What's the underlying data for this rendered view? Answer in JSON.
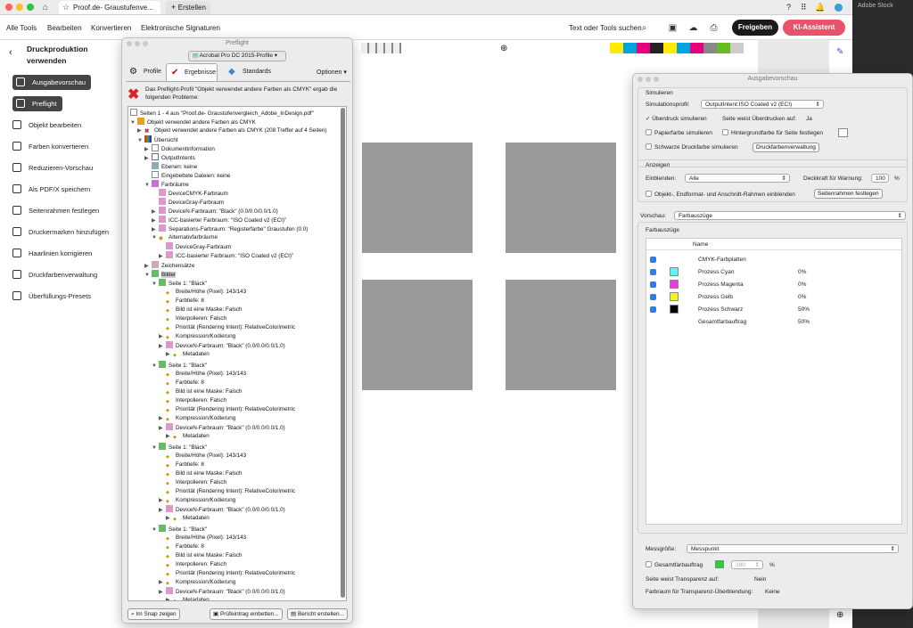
{
  "titlebar": {
    "tab1": "Proof.de- Graustufenve...",
    "tab2": "Erstellen",
    "app_label": "Adobe Stock"
  },
  "menubar": {
    "items": [
      "Alle Tools",
      "Bearbeiten",
      "Konvertieren",
      "Elektronische Signaturen"
    ],
    "search": "Text oder Tools suchen",
    "share": "Freigeben",
    "ai": "KI-Assistent"
  },
  "left": {
    "title1": "Druckproduktion",
    "title2": "verwenden",
    "items": [
      "Ausgabevorschau",
      "Preflight",
      "Objekt bearbeiten",
      "Farben konvertieren",
      "Reduzieren-Vorschau",
      "Als PDF/X speichern",
      "Seitenrahmen festlegen",
      "Druckermarken hinzufügen",
      "Haarlinien korrigieren",
      "Druckfarbenverwaltung",
      "Überfüllungs-Presets"
    ]
  },
  "preflight": {
    "title": "Preflight",
    "profile": "Acrobat Pro DC 2015-Profile",
    "tabs": [
      "Profile",
      "Ergebnisse",
      "Standards"
    ],
    "options": "Optionen",
    "msg": "Das Preflight-Profil \"Objekt verwendet andere Farben als CMYK\" ergab die folgenden Probleme:",
    "tree": [
      "Seiten 1 - 4 aus \"Proof.de- Graustufenvergleich_Adobe_InDesign.pdf\"",
      "Objekt verwendet andere Farben als CMYK",
      "Objekt verwendet andere Farben als CMYK (208 Treffer auf 4 Seiten)",
      "Übersicht",
      "Dokumentinformation",
      "OutputIntents",
      "Ebenen: keine",
      "Eingebettete Dateien: keine",
      "Farbräume",
      "DeviceCMYK-Farbraum",
      "DeviceGray-Farbraum",
      "DeviceN-Farbraum: \"Black\"  (0.0/0.0/0.0/1.0)",
      "ICC-basierter Farbraum: \"ISO Coated v2 (ECI)\"",
      "Separations-Farbraum: \"Registerfarbe\" Graustufen (0.0)",
      "Alternativfarbräume",
      "DeviceGray-Farbraum",
      "ICC-basierter Farbraum: \"ISO Coated v2 (ECI)\"",
      "Zeichensätze",
      "Bilder"
    ],
    "block": [
      "Seite 1: \"Black\"",
      "Breite/Höhe (Pixel): 143/143",
      "Farbtiefe: 8",
      "Bild ist eine Maske: Falsch",
      "Interpolieren: Falsch",
      "Priorität (Rendering Intent): RelativeColorimetric",
      "Kompression/Kodierung",
      "DeviceN-Farbraum: \"Black\"  (0.0/0.0/0.0/1.0)",
      "Metadaten"
    ],
    "btn_snap": "Im Snap zeigen",
    "btn_embed": "Prüfeintrag einbetten...",
    "btn_report": "Bericht erstellen..."
  },
  "av": {
    "title": "Ausgabevorschau",
    "simulieren": "Simulieren",
    "simprofil_label": "Simulationsprofil:",
    "simprofil": "OutputIntent:ISO Coated v2 (ECI)",
    "ueberdruck": "Überdruck simulieren",
    "weiss_label": "Seite weist Überdrucken auf:",
    "weiss_val": "Ja",
    "papier": "Papierfarbe simulieren",
    "hinter": "Hintergrundfarbe für Seite festlegen",
    "schwarz": "Schwarze Druckfarbe simulieren",
    "dfv_btn": "Druckfarbenverwaltung",
    "anzeigen": "Anzeigen",
    "einblenden_label": "Einblenden:",
    "einblenden": "Alle",
    "deckkraft_label": "Deckkraft für Warnung:",
    "deckkraft": "100",
    "pct": "%",
    "rahmen": "Objekt-, Endformat- und Anschnitt-Rahmen einblenden",
    "sr_btn": "Seitenrahmen festlegen",
    "vorschau_label": "Vorschau:",
    "vorschau": "Farbauszüge",
    "farbauszuege": "Farbauszüge",
    "name_col": "Name",
    "plates": [
      {
        "name": "CMYK-Farbplatten",
        "val": "",
        "color": ""
      },
      {
        "name": "Prozess Cyan",
        "val": "0%",
        "color": "#66f2f2"
      },
      {
        "name": "Prozess Magenta",
        "val": "0%",
        "color": "#f233e6"
      },
      {
        "name": "Prozess Gelb",
        "val": "0%",
        "color": "#f2f22a"
      },
      {
        "name": "Prozess Schwarz",
        "val": "50%",
        "color": "#000000"
      },
      {
        "name": "Gesamtfarbauftrag",
        "val": "50%",
        "color": ""
      }
    ],
    "mess_label": "Messgröße:",
    "mess": "Messpunkt",
    "gesamt": "Gesamtfarbauftrag",
    "gesamt_val": "280",
    "transp_label": "Seite weist Transparenz auf:",
    "transp_val": "Nein",
    "ueberbl_label": "Farbraum für Transparenz-Überblendung:",
    "ueberbl_val": "Keine"
  }
}
